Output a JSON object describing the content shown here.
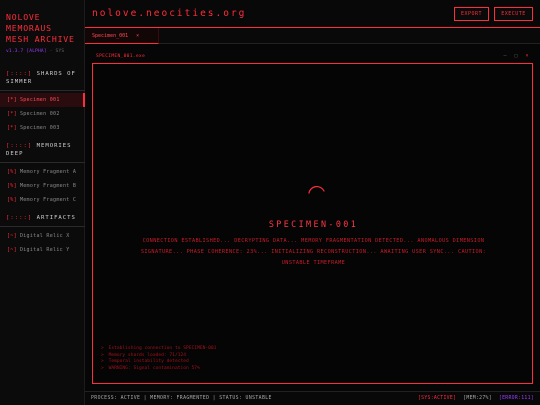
{
  "brand": {
    "title_line1": "NOLOVE",
    "title_line2": "MEMORAUS",
    "title_line3": "MESH ARCHIVE",
    "version": "v1.3.7",
    "channel": "[ALPHA]",
    "sys": "SYS"
  },
  "sidebar": {
    "sections": [
      {
        "bracket": "[::::]",
        "title": "SHARDS OF SIMMER",
        "items": [
          {
            "mark": "[*]",
            "label": "Specimen 001"
          },
          {
            "mark": "[*]",
            "label": "Specimen 002"
          },
          {
            "mark": "[*]",
            "label": "Specimen 003"
          }
        ]
      },
      {
        "bracket": "[::::]",
        "title": "MEMORIES DEEP",
        "items": [
          {
            "mark": "[%]",
            "label": "Memory Fragment A"
          },
          {
            "mark": "[%]",
            "label": "Memory Fragment B"
          },
          {
            "mark": "[%]",
            "label": "Memory Fragment C"
          }
        ]
      },
      {
        "bracket": "[::::]",
        "title": "ARTIFACTS",
        "items": [
          {
            "mark": "[~]",
            "label": "Digital Relic X"
          },
          {
            "mark": "[~]",
            "label": "Digital Relic Y"
          }
        ]
      }
    ]
  },
  "header": {
    "site_title": "nolove.neocities.org",
    "export_label": "EXPORT",
    "execute_label": "EXECUTE"
  },
  "tabs": [
    {
      "label": "Specimen_001",
      "close": "×"
    }
  ],
  "panel": {
    "title": "SPECIMEN_001.exe",
    "controls": {
      "minimize": "–",
      "maximize": "□",
      "close": "×"
    },
    "specimen_name": "SPECIMEN-001",
    "status_message": "CONNECTION ESTABLISHED... DECRYPTING DATA... MEMORY FRAGMENTATION DETECTED... ANOMALOUS DIMENSION SIGNATURE... PHASE COHERENCE: 23%... INITIALIZING RECONSTRUCTION... AWAITING USER SYNC... CAUTION: UNSTABLE TIMEFRAME",
    "log": [
      {
        "prompt": ">",
        "text": "Establishing connection to SPECIMEN-001"
      },
      {
        "prompt": ">",
        "text": "Memory shards loaded: 71/124"
      },
      {
        "prompt": ">",
        "text": "Temporal instability detected"
      },
      {
        "prompt": ">",
        "text": "WARNING: Signal contamination 57%"
      }
    ]
  },
  "footer": {
    "status_line": "PROCESS: ACTIVE | MEMORY: FRAGMENTED | STATUS: UNSTABLE",
    "sys": "[SYS:ACTIVE]",
    "mem": "[MEM:27%]",
    "err": "[ERROR:111]"
  },
  "colors": {
    "accent": "#ff2d3a",
    "purple": "#9b3dff",
    "background": "#060606"
  }
}
